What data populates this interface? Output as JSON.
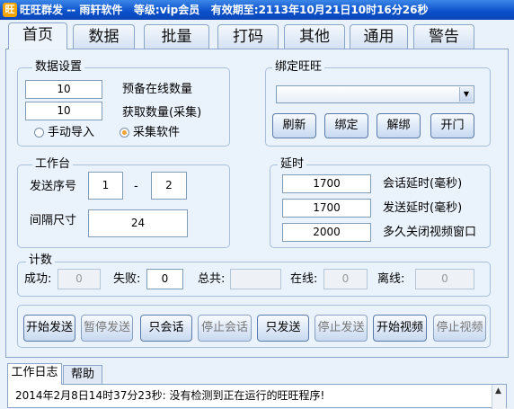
{
  "window": {
    "title_app": "旺旺群发",
    "title_sep": " -- ",
    "title_vendor": "雨轩软件",
    "title_level": "等级:vip会员",
    "title_expire": "有效期至:2113年10月21日10时16分26秒"
  },
  "tabs": [
    "首页",
    "数据",
    "批量",
    "打码",
    "其他",
    "通用",
    "警告"
  ],
  "data_settings": {
    "title": "数据设置",
    "reserve_value": "10",
    "reserve_label": "预备在线数量",
    "fetch_value": "10",
    "fetch_label": "获取数量(采集)",
    "radio_manual": "手动导入",
    "radio_collect": "采集软件"
  },
  "bind_wangwang": {
    "title": "绑定旺旺",
    "select_value": "",
    "refresh": "刷新",
    "bind": "绑定",
    "unbind": "解绑",
    "open": "开门"
  },
  "workbench": {
    "title": "工作台",
    "seq_label": "发送序号",
    "seq_from": "1",
    "dash": "-",
    "seq_to": "2",
    "gap_label": "间隔尺寸",
    "gap_value": "24"
  },
  "delay": {
    "title": "延时",
    "session_value": "1700",
    "session_label": "会话延时(毫秒)",
    "send_value": "1700",
    "send_label": "发送延时(毫秒)",
    "close_value": "2000",
    "close_label": "多久关闭视频窗口"
  },
  "stats": {
    "title": "计数",
    "success_label": "成功:",
    "success_value": "0",
    "fail_label": "失败:",
    "fail_value": "0",
    "total_label": "总共:",
    "total_value": "",
    "online_label": "在线:",
    "online_value": "0",
    "offline_label": "离线:",
    "offline_value": "0"
  },
  "actions": {
    "start_send": "开始发送",
    "pause_send": "暂停发送",
    "only_session": "只会话",
    "stop_session": "停止会话",
    "only_send": "只发送",
    "stop_send": "停止发送",
    "start_video": "开始视频",
    "stop_video": "停止视频"
  },
  "log": {
    "tab_worklog": "工作日志",
    "tab_help": "帮助",
    "line": "2014年2月8日14时37分23秒:  没有检测到正在运行的旺旺程序!"
  },
  "colors": {
    "titlebar": "#0a4fc9",
    "panel": "#eaf2fc",
    "radio_accent": "#f0a030"
  }
}
